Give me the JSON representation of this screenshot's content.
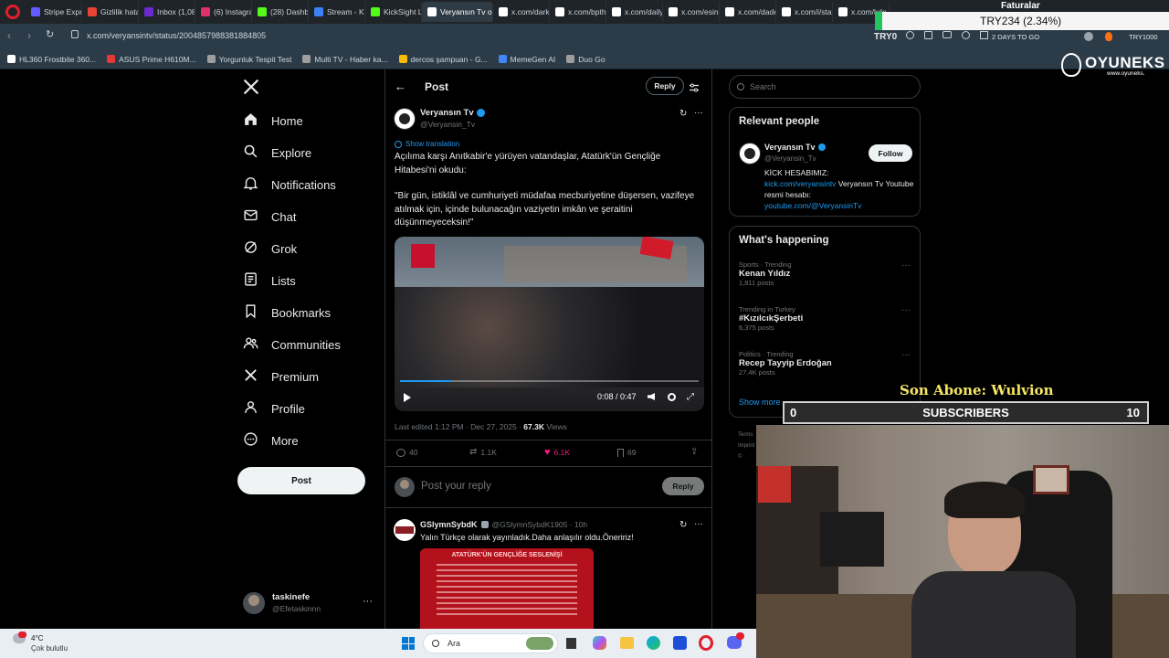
{
  "browser": {
    "tabs": [
      {
        "label": "Stripe Expre",
        "color": "#635bff"
      },
      {
        "label": "Gizlilik hata",
        "color": "#ea4335"
      },
      {
        "label": "Inbox (1,08",
        "color": "#6b2bd1"
      },
      {
        "label": "(6) Instagra",
        "color": "#e1306c"
      },
      {
        "label": "(28) Dashbo",
        "color": "#53fc18"
      },
      {
        "label": "Stream - Ki",
        "color": "#3b82f6"
      },
      {
        "label": "KickSight Li",
        "color": "#53fc18"
      },
      {
        "label": "Veryansın Tv on X: \"",
        "color": "#ffffff"
      },
      {
        "label": "x.com/dark",
        "color": "#ffffff"
      },
      {
        "label": "x.com/bpth",
        "color": "#ffffff"
      },
      {
        "label": "x.com/daily",
        "color": "#ffffff"
      },
      {
        "label": "x.com/esint",
        "color": "#ffffff"
      },
      {
        "label": "x.com/dade",
        "color": "#ffffff"
      },
      {
        "label": "x.com/i/stat",
        "color": "#ffffff"
      },
      {
        "label": "x.com/kde",
        "color": "#ffffff"
      }
    ],
    "url": "x.com/veryansintv/status/2004857988381884805",
    "bookmarks": [
      {
        "label": "HL360 Frostbite 360...",
        "color": "#ffffff"
      },
      {
        "label": "ASUS Prime H610M...",
        "color": "#e53935"
      },
      {
        "label": "Yorgunluk Tespit Test",
        "color": "#9e9e9e"
      },
      {
        "label": "Multi TV - Haber ka...",
        "color": "#9e9e9e"
      },
      {
        "label": "dercos şampuan - G...",
        "color": "#fbbc05"
      },
      {
        "label": "MemeGen AI",
        "color": "#4285f4"
      },
      {
        "label": "Duo Go",
        "color": "#9e9e9e"
      }
    ],
    "ext_labels": {
      "try0": "TRY0",
      "days": "2 DAYS TO GO",
      "tryk": "TRY1000"
    }
  },
  "overlay": {
    "stock_title": "Faturalar",
    "stock_value": "TRY234 (2.34%)",
    "brand": "OYUNEKS",
    "brand_sub": "www.oyuneks.",
    "son_abone": "Son Abone: Wulvion",
    "sub_left": "0",
    "sub_label": "SUBSCRIBERS",
    "sub_right": "10"
  },
  "nav": {
    "items": [
      {
        "label": "Home",
        "icon": "home-icon"
      },
      {
        "label": "Explore",
        "icon": "search-icon"
      },
      {
        "label": "Notifications",
        "icon": "bell-icon"
      },
      {
        "label": "Chat",
        "icon": "mail-icon"
      },
      {
        "label": "Grok",
        "icon": "grok-icon"
      },
      {
        "label": "Lists",
        "icon": "list-icon"
      },
      {
        "label": "Bookmarks",
        "icon": "bookmark-icon"
      },
      {
        "label": "Communities",
        "icon": "people-icon"
      },
      {
        "label": "Premium",
        "icon": "x-icon"
      },
      {
        "label": "Profile",
        "icon": "person-icon"
      },
      {
        "label": "More",
        "icon": "more-icon"
      }
    ],
    "post_label": "Post",
    "account_name": "taskinefe",
    "account_handle": "@Efetaskinnn"
  },
  "post": {
    "header_title": "Post",
    "reply_label": "Reply",
    "author_name": "Veryansın Tv",
    "author_handle": "@Veryansin_Tv",
    "show_translation": "Show translation",
    "text1": "Açılıma karşı Anıtkabir'e yürüyen vatandaşlar, Atatürk'ün Gençliğe Hitabesi'ni okudu:",
    "text2": "\"Bir gün, istiklâl ve cumhuriyeti müdafaa mecburiyetine düşersen, vazifeye atılmak için, içinde bulunacağın vaziyetin imkân ve şeraitini düşünmeyeceksin!\"",
    "video_time": "0:08 / 0:47",
    "video_progress": 0.17,
    "meta": "Last edited 1:12 PM · Dec 27, 2025 · ",
    "views": "67.3K",
    "views_label": " Views",
    "stats": {
      "replies": "40",
      "reposts": "1.1K",
      "likes": "6.1K",
      "bookmarks": "69"
    },
    "reply_placeholder": "Post your reply",
    "reply_button": "Reply"
  },
  "reply_tweet": {
    "author_name": "GSlymnSybdK",
    "author_handle": "@GSlymnSybdK1905 · 10h",
    "text": "Yalın Türkçe olarak yayınladık.Daha anlaşılır oldu.Öneririz!",
    "image_title": "ATATÜRK'ÜN GENÇLİĞE SESLENİŞİ"
  },
  "sidebar": {
    "search_placeholder": "Search",
    "relevant_title": "Relevant people",
    "person_name": "Veryansın Tv",
    "person_handle": "@Veryansin_Tv",
    "follow_label": "Follow",
    "bio_line1": "KİCK HESABIMIZ:",
    "bio_link1": "kick.com/veryansintv",
    "bio_line2": " Veryansın Tv Youtube resmi hesabı:",
    "bio_link2": "youtube.com/@VeryansinTv",
    "happening_title": "What's happening",
    "trends": [
      {
        "cat": "Sports · Trending",
        "name": "Kenan Yıldız",
        "posts": "1,811 posts"
      },
      {
        "cat": "Trending in Turkey",
        "name": "#KızılcıkŞerbeti",
        "posts": "6,375 posts"
      },
      {
        "cat": "Politics · Trending",
        "name": "Recep Tayyip Erdoğan",
        "posts": "27.4K posts"
      }
    ],
    "show_more": "Show more"
  },
  "taskbar": {
    "weather_temp": "4°C",
    "weather_desc": "Çok bulutlu",
    "search_label": "Ara"
  }
}
